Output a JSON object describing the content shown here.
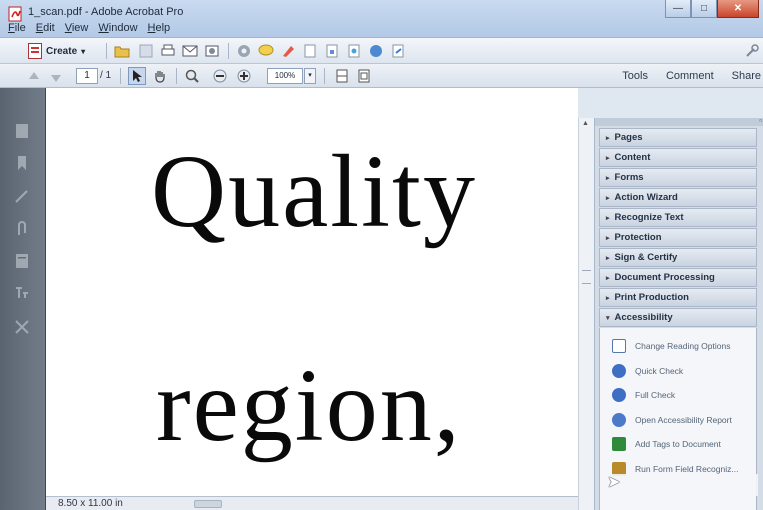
{
  "window": {
    "title": "1_scan.pdf - Adobe Acrobat Pro",
    "controls": {
      "minimize": "—",
      "maximize": "□",
      "close": "✕"
    }
  },
  "menu": {
    "items": [
      {
        "underline": "F",
        "rest": "ile"
      },
      {
        "underline": "E",
        "rest": "dit"
      },
      {
        "underline": "V",
        "rest": "iew"
      },
      {
        "underline": "W",
        "rest": "indow"
      },
      {
        "underline": "H",
        "rest": "elp"
      }
    ]
  },
  "toolbar": {
    "create_label": "Create",
    "create_arrow": "▾",
    "page_current": "1",
    "page_total": "/ 1",
    "zoom_value": "100%",
    "zoom_arrow": "▾"
  },
  "right_tabs": [
    "Tools",
    "Comment",
    "Share"
  ],
  "document": {
    "word1": "Quality",
    "word2": "region,"
  },
  "status": {
    "page_size": "8.50 x 11.00 in"
  },
  "panels": [
    {
      "label": "Pages",
      "tri": "▸"
    },
    {
      "label": "Content",
      "tri": "▸"
    },
    {
      "label": "Forms",
      "tri": "▸"
    },
    {
      "label": "Action Wizard",
      "tri": "▸"
    },
    {
      "label": "Recognize Text",
      "tri": "▸"
    },
    {
      "label": "Protection",
      "tri": "▸"
    },
    {
      "label": "Sign & Certify",
      "tri": "▸"
    },
    {
      "label": "Document Processing",
      "tri": "▸"
    },
    {
      "label": "Print Production",
      "tri": "▸"
    },
    {
      "label": "Accessibility",
      "tri": "▾"
    }
  ],
  "accessibility_tools": [
    {
      "label": "Change Reading Options",
      "color": "#5577aa"
    },
    {
      "label": "Quick Check",
      "color": "#3f6fc4"
    },
    {
      "label": "Full Check",
      "color": "#3f6fc4"
    },
    {
      "label": "Open Accessibility Report",
      "color": "#4c79c8"
    },
    {
      "label": "Add Tags to Document",
      "color": "#2f8a3c"
    },
    {
      "label": "Run Form Field Recogniz...",
      "color": "#b88a2a"
    }
  ]
}
